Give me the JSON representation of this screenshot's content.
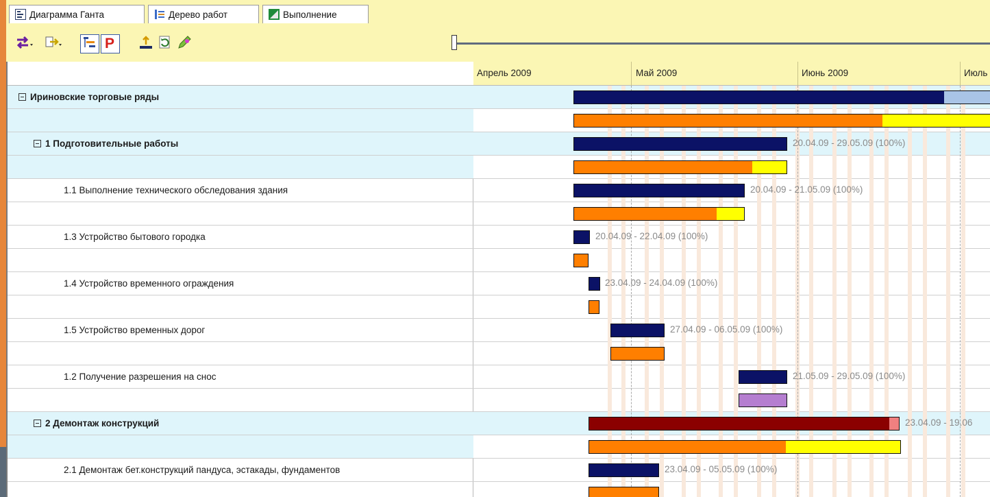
{
  "tabs": [
    {
      "label": "Диаграмма Ганта",
      "icon": "gantt-icon",
      "active": true
    },
    {
      "label": "Дерево работ",
      "icon": "tree-icon",
      "active": false
    },
    {
      "label": "Выполнение",
      "icon": "progress-icon",
      "active": false
    }
  ],
  "toolbar": {
    "buttons": [
      "swap-arrows-icon",
      "indent-icon",
      "outline-icon",
      "resource-p-icon",
      "baseline-icon",
      "refresh-icon",
      "pencil-icon"
    ]
  },
  "timeline": {
    "months": [
      "Апрель 2009",
      "Май 2009",
      "Июнь 2009",
      "Июль"
    ]
  },
  "tasks": [
    {
      "name": "Ириновские торговые ряды",
      "summary": true,
      "level": 0,
      "label": ""
    },
    {
      "name": "1 Подготовительные работы",
      "summary": true,
      "level": 1,
      "label": "20.04.09 - 29.05.09 (100%)"
    },
    {
      "name": "1.1 Выполнение технического обследования здания",
      "summary": false,
      "level": 2,
      "label": "20.04.09 - 21.05.09 (100%)"
    },
    {
      "name": "1.3 Устройство бытового городка",
      "summary": false,
      "level": 2,
      "label": "20.04.09 - 22.04.09 (100%)"
    },
    {
      "name": "1.4 Устройство временного ограждения",
      "summary": false,
      "level": 2,
      "label": "23.04.09 - 24.04.09 (100%)"
    },
    {
      "name": "1.5 Устройство временных дорог",
      "summary": false,
      "level": 2,
      "label": "27.04.09 - 06.05.09 (100%)"
    },
    {
      "name": "1.2 Получение разрешения на снос",
      "summary": false,
      "level": 2,
      "label": "21.05.09 - 29.05.09 (100%)"
    },
    {
      "name": "2 Демонтаж конструкций",
      "summary": true,
      "level": 1,
      "label": "23.04.09 - 19.06"
    },
    {
      "name": "2.1 Демонтаж бет.конструкций пандуса, эстакады, фундаментов",
      "summary": false,
      "level": 2,
      "label": "23.04.09 - 05.05.09 (100%)"
    }
  ],
  "colors": {
    "plan_bar": "#0b1266",
    "plan_bar_remaining": "#a9c4e6",
    "actual_bar": "#ff7f00",
    "actual_bar_remaining": "#ffff00",
    "critical_bar": "#8b0000",
    "critical_bar_remaining": "#f08080",
    "permit_bar": "#b57ed0",
    "summary_row_bg": "#dff5fb",
    "weekend_stripe": "#f9e9dc"
  }
}
